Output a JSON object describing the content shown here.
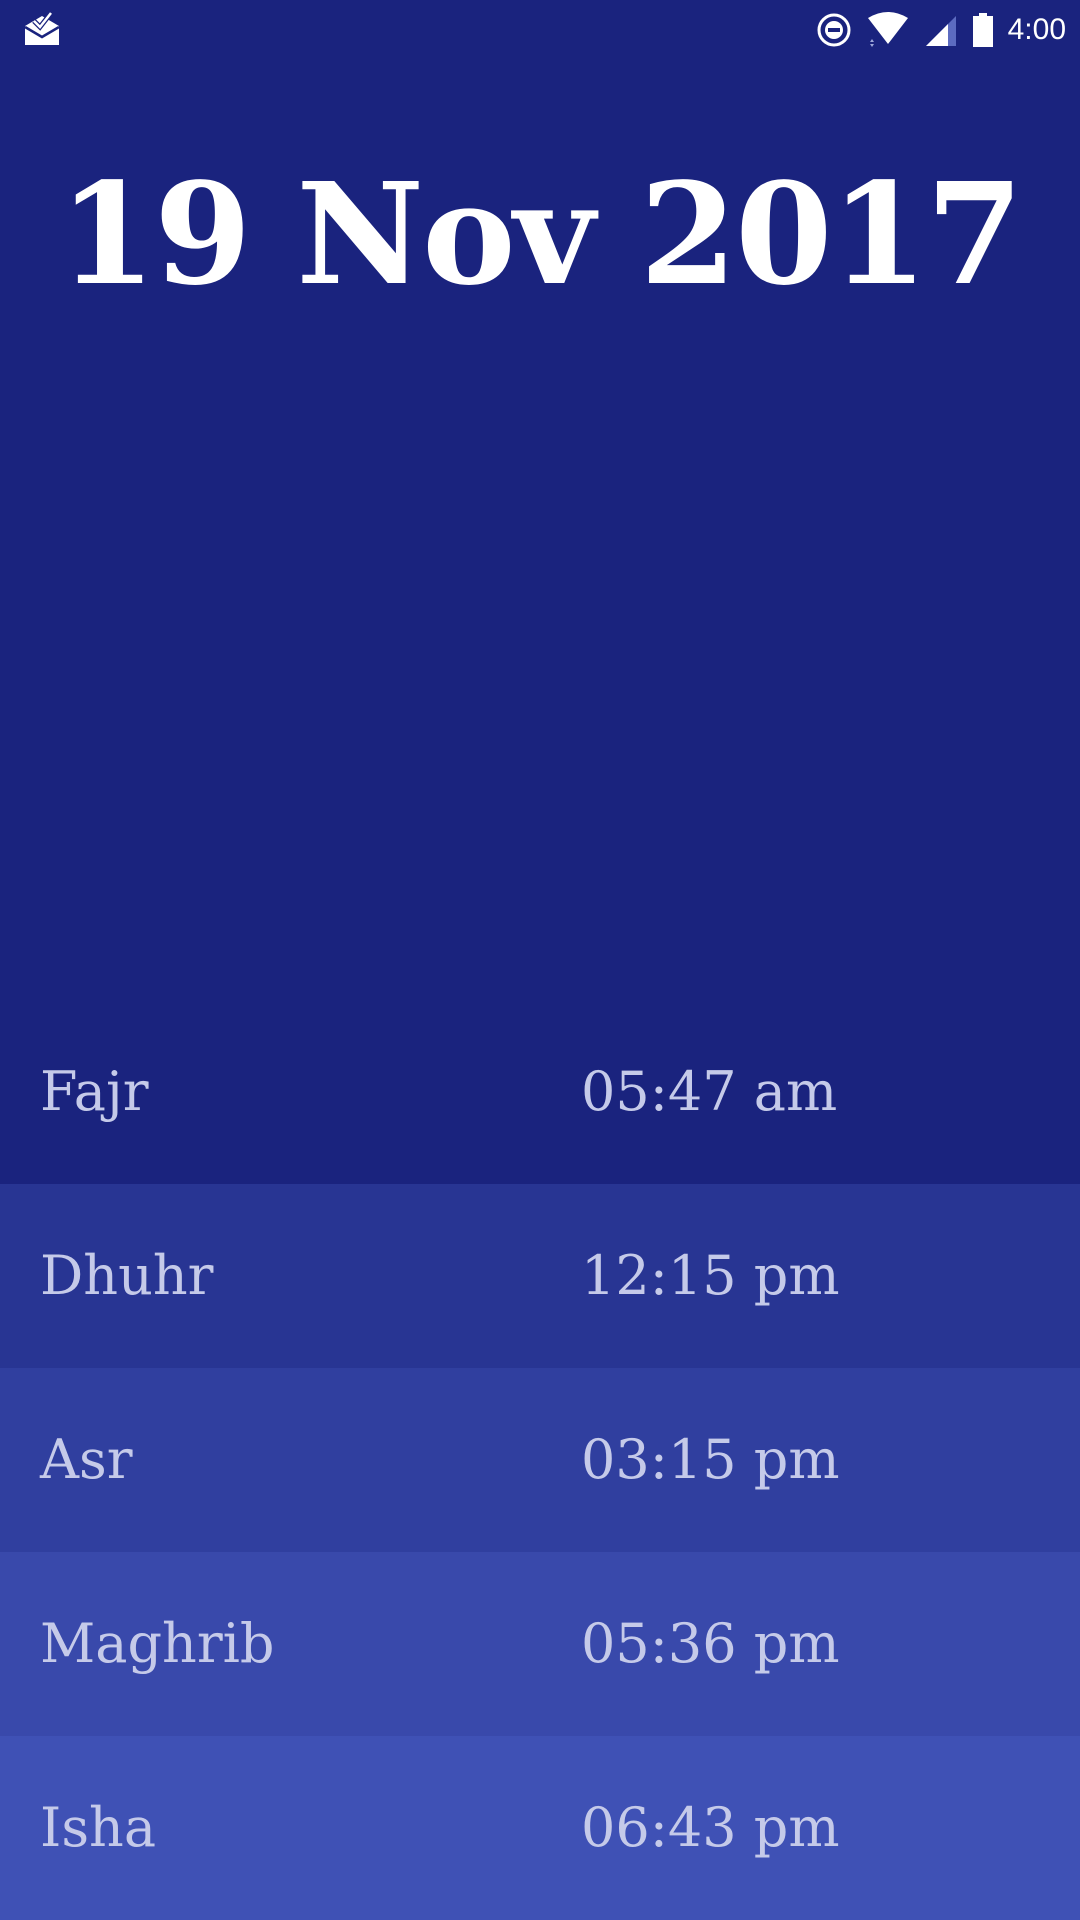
{
  "status_bar": {
    "time": "4:00",
    "icons": [
      "mail-check-icon",
      "do-not-disturb-icon",
      "wifi-icon",
      "cell-signal-icon",
      "battery-icon"
    ]
  },
  "header": {
    "date": "19 Nov 2017"
  },
  "prayers": [
    {
      "name": "Fajr",
      "time": "05:47 am",
      "color": "#1a237e"
    },
    {
      "name": "Dhuhr",
      "time": "12:15 pm",
      "color": "#283593"
    },
    {
      "name": "Asr",
      "time": "03:15 pm",
      "color": "#303f9f"
    },
    {
      "name": "Maghrib",
      "time": "05:36 pm",
      "color": "#3949ab"
    },
    {
      "name": "Isha",
      "time": "06:43 pm",
      "color": "#3f51b5"
    }
  ],
  "colors": {
    "background": "#1a237e",
    "title_text": "#ffffff",
    "row_text": "#c5cae9"
  }
}
